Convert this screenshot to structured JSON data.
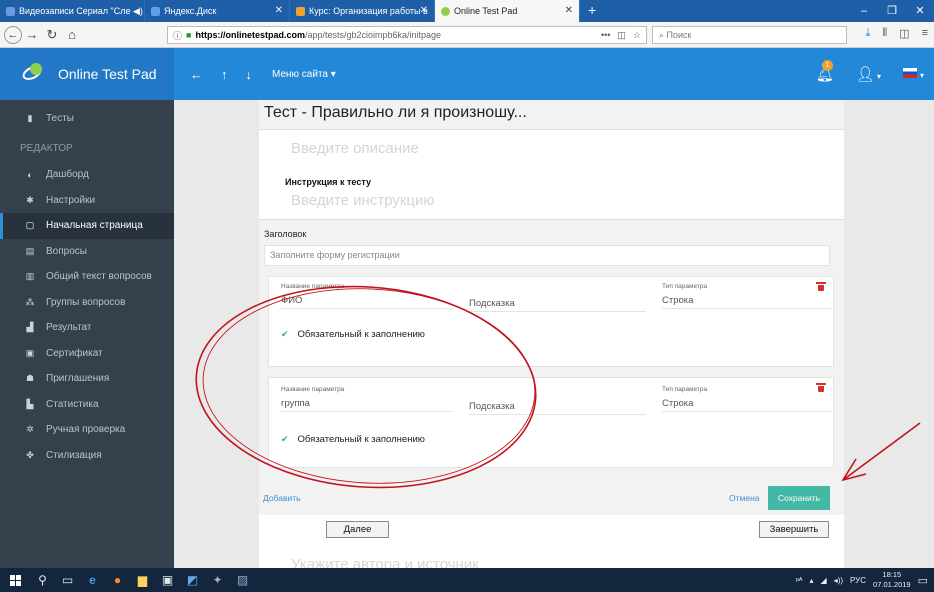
{
  "browser": {
    "tabs": [
      {
        "label": "Видеозаписи Сериал \"Сле ◀) ✕",
        "color": "#6a9be0"
      },
      {
        "label": "Яндекс.Диск",
        "color": "#5aa0e8"
      },
      {
        "label": "Курс: Организация работы в",
        "color": "#f0a030"
      },
      {
        "label": "Online Test Pad",
        "color": "#8fd14f"
      }
    ],
    "url_host": "https://onlinetestpad.com",
    "url_path": "/app/tests/gb2cioimpb6ka/initpage",
    "search_placeholder": "Поиск"
  },
  "app": {
    "logo_text": "Online Test Pad",
    "menu_label": "Меню сайта",
    "notification_count": "1"
  },
  "sidebar": {
    "tests": "Тесты",
    "section_label": "РЕДАКТОР",
    "items": [
      {
        "label": "Дашборд",
        "icon": "dashboard-icon",
        "glyph": "◐"
      },
      {
        "label": "Настройки",
        "icon": "gear-icon",
        "glyph": "✱"
      },
      {
        "label": "Начальная страница",
        "icon": "page-icon",
        "glyph": "▢"
      },
      {
        "label": "Вопросы",
        "icon": "questions-icon",
        "glyph": "▤"
      },
      {
        "label": "Общий текст вопросов",
        "icon": "text-icon",
        "glyph": "▥"
      },
      {
        "label": "Группы вопросов",
        "icon": "groups-icon",
        "glyph": "⁂"
      },
      {
        "label": "Результат",
        "icon": "result-icon",
        "glyph": "▟"
      },
      {
        "label": "Сертификат",
        "icon": "certificate-icon",
        "glyph": "▣"
      },
      {
        "label": "Приглашения",
        "icon": "invite-icon",
        "glyph": "☗"
      },
      {
        "label": "Статистика",
        "icon": "stats-icon",
        "glyph": "▙"
      },
      {
        "label": "Ручная проверка",
        "icon": "check-icon",
        "glyph": "✲"
      },
      {
        "label": "Стилизация",
        "icon": "style-icon",
        "glyph": "✤"
      }
    ],
    "active_index": 2
  },
  "main": {
    "test_title": "Тест - Правильно ли я произношу...",
    "description_placeholder": "Введите описание",
    "instruction_label": "Инструкция к тесту",
    "instruction_placeholder": "Введите инструкцию",
    "form": {
      "title_label": "Заголовок",
      "title_value": "Заполните форму регистрации",
      "params": [
        {
          "name_label": "Название параметра",
          "name_value": "ФИО",
          "hint_value": "Подсказка",
          "type_label": "Тип параметра",
          "type_value": "Строка",
          "required_label": "Обязательный к заполнению"
        },
        {
          "name_label": "Название параметра",
          "name_value": "группа",
          "hint_value": "Подсказка",
          "type_label": "Тип параметра",
          "type_value": "Строка",
          "required_label": "Обязательный к заполнению"
        }
      ],
      "add_label": "Добавить",
      "cancel_label": "Отмена",
      "save_label": "Сохранить"
    },
    "next_label": "Далее",
    "finish_label": "Завершить",
    "author_placeholder": "Укажите автора и источник"
  },
  "taskbar": {
    "lang": "РУС",
    "time": "18:15",
    "date": "07.01.2019"
  },
  "colors": {
    "header_blue": "#2488d8",
    "sidebar_bg": "#34404b",
    "save_green": "#43b8a4",
    "annotation_red": "#c0141e"
  }
}
